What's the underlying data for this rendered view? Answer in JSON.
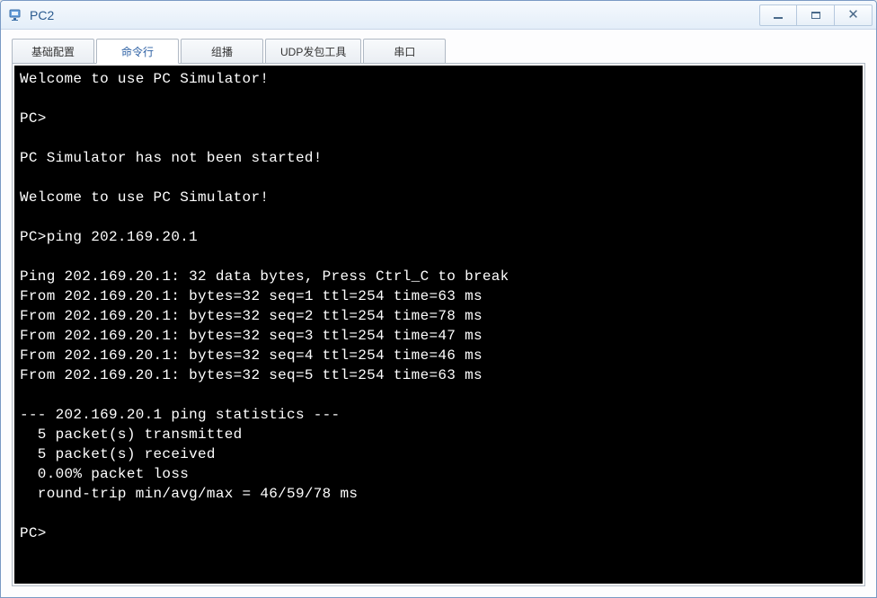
{
  "window": {
    "title": "PC2"
  },
  "tabs": {
    "items": [
      {
        "label": "基础配置"
      },
      {
        "label": "命令行"
      },
      {
        "label": "组播"
      },
      {
        "label": "UDP发包工具"
      },
      {
        "label": "串口"
      }
    ],
    "active_index": 1
  },
  "terminal": {
    "lines": [
      "Welcome to use PC Simulator!",
      "",
      "PC>",
      "",
      "PC Simulator has not been started!",
      "",
      "Welcome to use PC Simulator!",
      "",
      "PC>ping 202.169.20.1",
      "",
      "Ping 202.169.20.1: 32 data bytes, Press Ctrl_C to break",
      "From 202.169.20.1: bytes=32 seq=1 ttl=254 time=63 ms",
      "From 202.169.20.1: bytes=32 seq=2 ttl=254 time=78 ms",
      "From 202.169.20.1: bytes=32 seq=3 ttl=254 time=47 ms",
      "From 202.169.20.1: bytes=32 seq=4 ttl=254 time=46 ms",
      "From 202.169.20.1: bytes=32 seq=5 ttl=254 time=63 ms",
      "",
      "--- 202.169.20.1 ping statistics ---",
      "  5 packet(s) transmitted",
      "  5 packet(s) received",
      "  0.00% packet loss",
      "  round-trip min/avg/max = 46/59/78 ms",
      "",
      "PC>"
    ]
  }
}
